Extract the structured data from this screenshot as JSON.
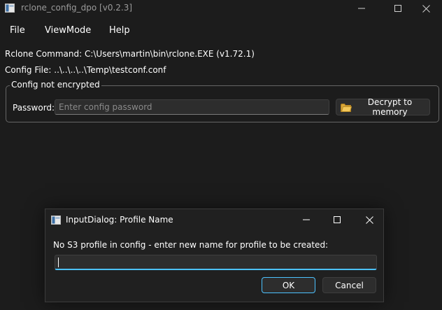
{
  "window": {
    "title": "rclone_config_dpo [v0.2.3]",
    "icon": "app-window-icon",
    "controls": [
      "minimize-icon",
      "maximize-icon",
      "close-icon"
    ]
  },
  "menu": {
    "items": [
      "File",
      "ViewMode",
      "Help"
    ]
  },
  "info": {
    "rclone_command": "Rclone Command: C:\\Users\\martin\\bin\\rclone.EXE (v1.72.1)",
    "config_file": "Config File: ..\\..\\..\\..\\Temp\\testconf.conf"
  },
  "encryption": {
    "group_title": "Config not encrypted",
    "password_label": "Password:",
    "password_placeholder": "Enter config password",
    "decrypt_label": "Decrypt to memory",
    "decrypt_icon": "folder-icon"
  },
  "dialog": {
    "title": "InputDialog: Profile Name",
    "message": "No S3 profile in config - enter new name for profile to be created:",
    "input_value": "",
    "ok_label": "OK",
    "cancel_label": "Cancel",
    "accent": "#4cc2ff"
  },
  "colors": {
    "background": "#1c1c1c",
    "dialog_background": "#202020",
    "text": "#ffffff",
    "accent": "#4cc2ff"
  }
}
